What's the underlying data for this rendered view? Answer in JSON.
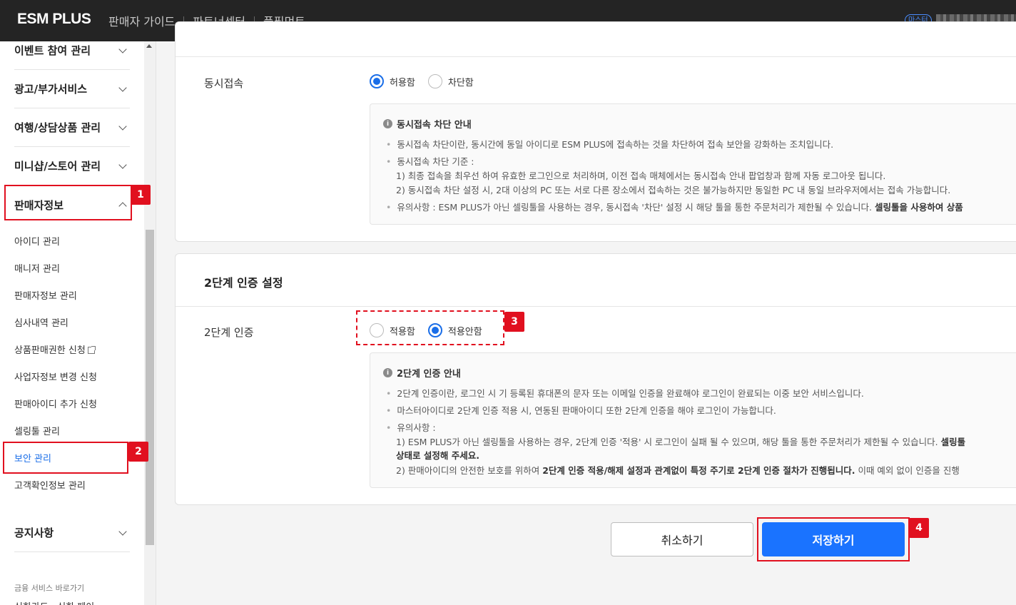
{
  "header": {
    "logo": "ESM PLUS",
    "nav": [
      "판매자 가이드",
      "파트너센터",
      "풀필먼트"
    ],
    "master_badge": "마스터"
  },
  "sidebar": {
    "main_menus": {
      "event": "이벤트 참여 관리",
      "ads": "광고/부가서비스",
      "travel": "여행/상담상품 관리",
      "minishop": "미니샵/스토어 관리",
      "seller_info": "판매자정보",
      "notice": "공지사항"
    },
    "sub_items": [
      "아이디 관리",
      "매니저 관리",
      "판매자정보 관리",
      "심사내역 관리",
      "상품판매권한 신청",
      "사업자정보 변경 신청",
      "판매아이디 추가 신청",
      "셀링툴 관리",
      "보안 관리",
      "고객확인정보 관리"
    ],
    "active_item": "보안 관리",
    "finance_label": "금융 서비스 바로가기",
    "finance_next": "신한카드 · 신한 페이"
  },
  "concurrent": {
    "label": "동시접속",
    "options": [
      "허용함",
      "차단함"
    ],
    "selected": "허용함",
    "info_title": "동시접속 차단 안내",
    "line1": "동시접속 차단이란, 동시간에 동일 아이디로 ESM PLUS에 접속하는 것을 차단하여 접속 보안을 강화하는 조치입니다.",
    "line2": "동시접속 차단 기준 :",
    "line2_sub1": "1) 최종 접속을 최우선 하여 유효한 로그인으로 처리하며, 이전 접속 매체에서는 동시접속 안내 팝업창과 함께 자동 로그아웃 됩니다.",
    "line2_sub2": "2) 동시접속 차단 설정 시, 2대 이상의 PC 또는 서로 다른 장소에서 접속하는 것은 불가능하지만 동일한 PC 내 동일 브라우저에서는 접속 가능합니다.",
    "line3": "유의사항 : ESM PLUS가 아닌 셀링툴을 사용하는 경우, 동시접속 '차단' 설정 시 해당 툴을 통한 주문처리가 제한될 수 있습니다.",
    "line3_bold": "셀링툴을 사용하여 상품"
  },
  "two_factor": {
    "section_title": "2단계 인증 설정",
    "label": "2단계 인증",
    "options": [
      "적용함",
      "적용안함"
    ],
    "selected": "적용안함",
    "info_title": "2단계 인증 안내",
    "line1": "2단계 인증이란, 로그인 시 기 등록된 휴대폰의 문자 또는 이메일 인증을 완료해야 로그인이 완료되는 이중 보안 서비스입니다.",
    "line2": "마스터아이디로 2단계 인증 적용 시, 연동된 판매아이디 또한 2단계 인증을 해야 로그인이 가능합니다.",
    "line3": "유의사항 :",
    "sub1": "1) ESM PLUS가 아닌 셀링툴을 사용하는 경우, 2단계 인증 '적용' 시 로그인이 실패 될 수 있으며, 해당 툴을 통한 주문처리가 제한될 수 있습니다.",
    "sub1_bold": "셀링툴",
    "sub1_cont": "상태로 설정해 주세요.",
    "sub2_a": "2) 판매아이디의 안전한 보호를 위하여",
    "sub2_bold": "2단계 인증 적용/해제 설정과 관계없이 특정 주기로 2단계 인증 절차가 진행됩니다.",
    "sub2_c": "이때 예외 없이 인증을 진행"
  },
  "buttons": {
    "cancel": "취소하기",
    "save": "저장하기"
  },
  "annotations": [
    "1",
    "2",
    "3",
    "4"
  ],
  "colors": {
    "accent": "#1a73ff",
    "annotation_red": "#e1101f",
    "topbar": "#242424"
  }
}
